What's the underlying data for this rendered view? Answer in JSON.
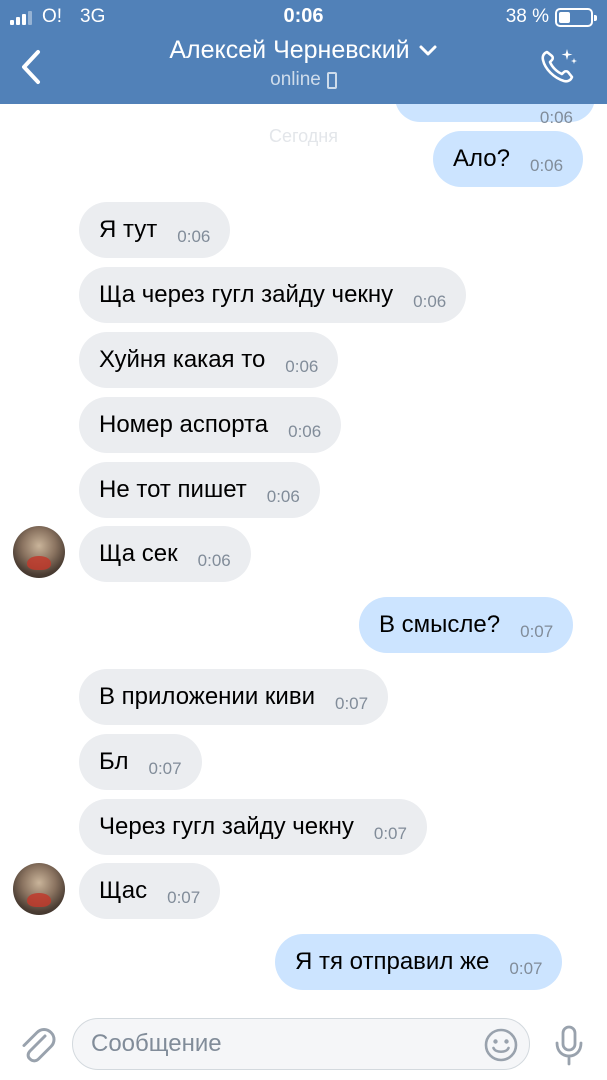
{
  "status_bar": {
    "carrier": "O!",
    "network": "3G",
    "time": "0:06",
    "battery_percent": "38 %",
    "battery_level": 0.38
  },
  "header": {
    "contact_name": "Алексей Черневский",
    "presence": "online",
    "icons": {
      "back": "back-chevron-icon",
      "dropdown": "chevron-down-icon",
      "call": "phone-call-icon",
      "device": "mobile-device-icon"
    },
    "accent_color": "#5181b8"
  },
  "chat": {
    "date_separator": "Сегодня",
    "incoming_bubble_color": "#ebedf0",
    "outgoing_bubble_color": "#cce4ff",
    "messages": [
      {
        "direction": "out",
        "text": "",
        "time": "0:06"
      },
      {
        "direction": "out",
        "text": "Ало?",
        "time": "0:06"
      },
      {
        "direction": "in",
        "text": "Я тут",
        "time": "0:06"
      },
      {
        "direction": "in",
        "text": "Ща через гугл зайду чекну",
        "time": "0:06"
      },
      {
        "direction": "in",
        "text": "Хуйня какая то",
        "time": "0:06"
      },
      {
        "direction": "in",
        "text": "Номер аспорта",
        "time": "0:06"
      },
      {
        "direction": "in",
        "text": "Не тот пишет",
        "time": "0:06"
      },
      {
        "direction": "in",
        "text": "Ща сек",
        "time": "0:06"
      },
      {
        "direction": "out",
        "text": "В смысле?",
        "time": "0:07"
      },
      {
        "direction": "in",
        "text": "В приложении киви",
        "time": "0:07"
      },
      {
        "direction": "in",
        "text": "Бл",
        "time": "0:07"
      },
      {
        "direction": "in",
        "text": "Через гугл зайду чекну",
        "time": "0:07"
      },
      {
        "direction": "in",
        "text": "Щас",
        "time": "0:07"
      },
      {
        "direction": "out",
        "text": "Я тя отправил же",
        "time": "0:07"
      }
    ]
  },
  "composer": {
    "placeholder": "Сообщение",
    "value": "",
    "icons": {
      "attach": "paperclip-icon",
      "emoji": "smile-icon",
      "voice": "microphone-icon"
    }
  }
}
